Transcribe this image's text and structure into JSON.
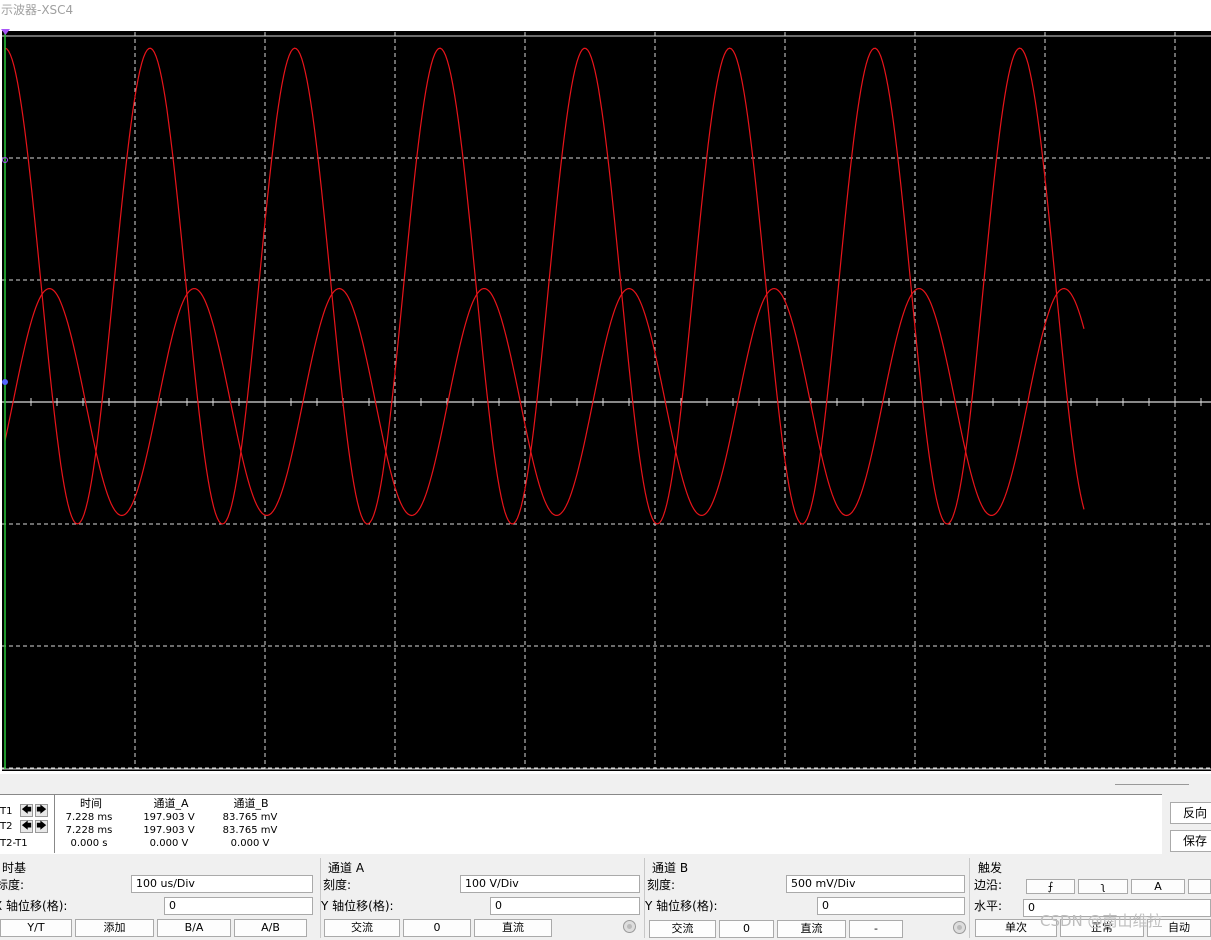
{
  "window": {
    "title": "示波器-XSC4"
  },
  "colors": {
    "trace": "#e8141a",
    "screen_bg": "#000000",
    "grid": "#d9d9d9",
    "cursor1": "#29c83a",
    "cursor_marker": "#a855f7"
  },
  "chart_data": {
    "type": "line",
    "x_unit": "div",
    "y_unit": "div",
    "grid": true,
    "xlim": [
      0,
      9.3
    ],
    "ylim": [
      -3,
      3
    ],
    "x_label": "",
    "y_label": "",
    "series": [
      {
        "color": "#e8141a",
        "waveform": "sine",
        "amplitude_div": 1.95,
        "offset_div": 0.95,
        "period_div": 1.115,
        "start_div": 0,
        "end_div": 8.3,
        "phase_deg": 90
      },
      {
        "color": "#e8141a",
        "waveform": "sine",
        "amplitude_div": 0.93,
        "offset_div": 0.0,
        "period_div": 1.115,
        "start_div": 0,
        "end_div": 8.3,
        "phase_deg": -20
      }
    ]
  },
  "readout": {
    "headers": {
      "time": "时间",
      "ch_a": "通道_A",
      "ch_b": "通道_B"
    },
    "rows": [
      {
        "label": "T1",
        "time": "7.228 ms",
        "ch_a": "197.903 V",
        "ch_b": "83.765 mV"
      },
      {
        "label": "T2",
        "time": "7.228 ms",
        "ch_a": "197.903 V",
        "ch_b": "83.765 mV"
      },
      {
        "label": "T2-T1",
        "time": "0.000 s",
        "ch_a": "0.000 V",
        "ch_b": "0.000 V"
      }
    ],
    "left_arrow": "🡄",
    "right_arrow": "🡆"
  },
  "side_buttons": {
    "reverse": "反向",
    "save": "保存"
  },
  "timebase": {
    "title": "时基",
    "scale_label": "标度:",
    "scale_value": "100 us/Div",
    "xpos_label": "X 轴位移(格):",
    "xpos_value": "0",
    "buttons": [
      "Y/T",
      "添加",
      "B/A",
      "A/B"
    ]
  },
  "channel_a": {
    "title": "通道 A",
    "scale_label": "刻度:",
    "scale_value": "100  V/Div",
    "ypos_label": "Y 轴位移(格):",
    "ypos_value": "0",
    "buttons": [
      "交流",
      "0",
      "直流"
    ]
  },
  "channel_b": {
    "title": "通道 B",
    "scale_label": "刻度:",
    "scale_value": "500 mV/Div",
    "ypos_label": "Y 轴位移(格):",
    "ypos_value": "0",
    "buttons": [
      "交流",
      "0",
      "直流",
      "-"
    ]
  },
  "trigger": {
    "title": "触发",
    "edge_label": "边沿:",
    "edge_buttons": [
      "⨍",
      "ʅ",
      "A",
      ""
    ],
    "level_label": "水平:",
    "level_value": "0",
    "mode_buttons": [
      "单次",
      "正常",
      "自动"
    ]
  },
  "watermark": "CSDN @南山维拉"
}
